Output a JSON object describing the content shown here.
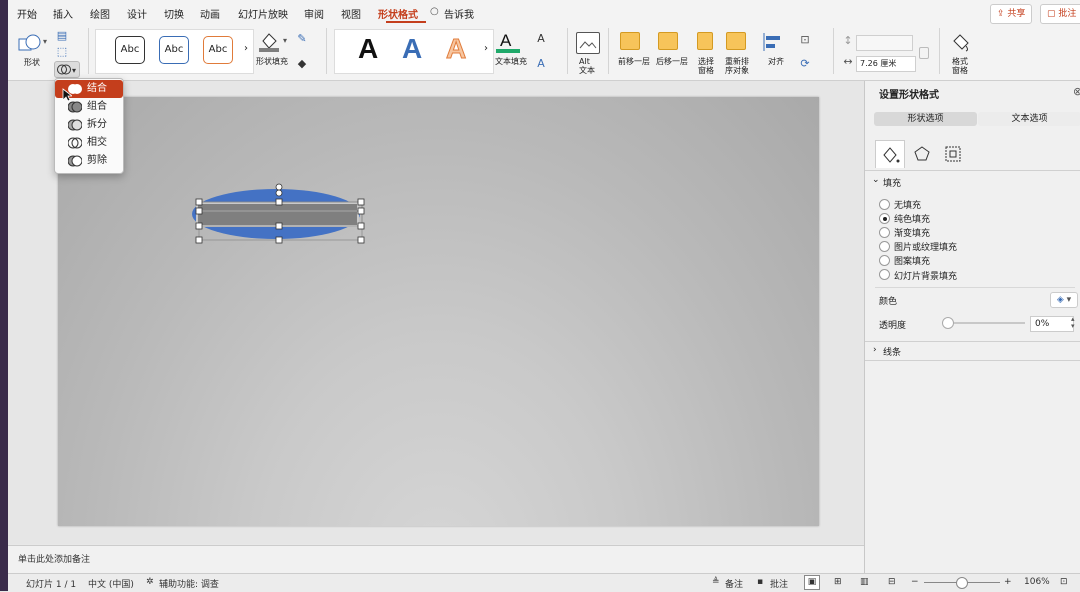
{
  "ribbon": {
    "tabs": [
      "开始",
      "插入",
      "绘图",
      "设计",
      "切换",
      "动画",
      "幻灯片放映",
      "审阅",
      "视图",
      "形状格式",
      "告诉我"
    ],
    "active_tab": "形状格式",
    "share_label": "共享",
    "comment_label": "批注",
    "shape_label": "形状",
    "shape_style_samples": [
      "Abc",
      "Abc",
      "Abc"
    ],
    "shape_fill_label": "形状填充",
    "wordart_samples": [
      "A",
      "A",
      "A"
    ],
    "text_fill_label": "文本填充",
    "alt_text_label": "Alt\n文本",
    "alt_text_line1": "Alt",
    "alt_text_line2": "文本",
    "bring_forward_label": "前移一层",
    "send_backward_label": "后移一层",
    "selection_pane_line1": "选择",
    "selection_pane_line2": "窗格",
    "reorder_line1": "重新排",
    "reorder_line2": "序对象",
    "align_label": "对齐",
    "width_value": "7.26 厘米",
    "format_pane_line1": "格式",
    "format_pane_line2": "窗格",
    "accent_color": "#c43e1c"
  },
  "merge_menu": {
    "items": [
      "结合",
      "组合",
      "拆分",
      "相交",
      "剪除"
    ],
    "selected": "结合"
  },
  "notes_placeholder": "单击此处添加备注",
  "status_bar": {
    "slide_info": "幻灯片 1 / 1",
    "language": "中文 (中国)",
    "accessibility": "辅助功能: 调查",
    "notes_label": "备注",
    "comments_label": "批注",
    "zoom": "106%"
  },
  "format_panel": {
    "title": "设置形状格式",
    "tabs": [
      "形状选项",
      "文本选项"
    ],
    "fill_section": "填充",
    "fill_options": [
      "无填充",
      "纯色填充",
      "渐变填充",
      "图片或纹理填充",
      "图案填充",
      "幻灯片背景填充"
    ],
    "selected_fill": "纯色填充",
    "color_label": "颜色",
    "transparency_label": "透明度",
    "transparency_value": "0%",
    "transparency_level": 0,
    "line_section": "线条"
  },
  "colors": {
    "shape_blue": "#4472c4",
    "band_gray": "#7f7f7f",
    "text_fill_green": "#1fa96a"
  }
}
